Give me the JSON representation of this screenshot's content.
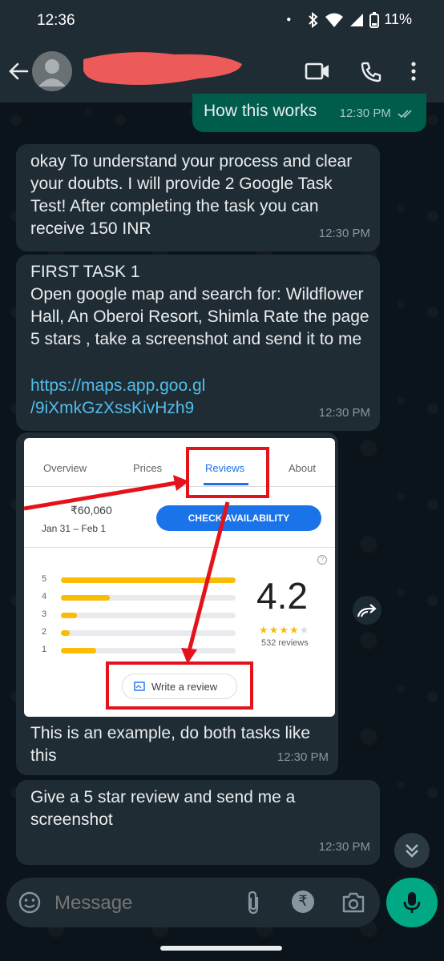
{
  "status_bar": {
    "time": "12:36",
    "battery": "11%"
  },
  "header": {
    "contact_name": ""
  },
  "messages": {
    "m0": {
      "text": "How this works",
      "time": "12:30 PM"
    },
    "m1": {
      "text": "okay To understand your process and clear your doubts. I will provide 2 Google Task Test! After completing the task you can receive 150 INR",
      "time": "12:30 PM"
    },
    "m2": {
      "text": "FIRST TASK 1\nOpen google map and search for: Wildflower Hall, An Oberoi Resort, Shimla Rate the page 5 stars , take a screenshot and send it to me",
      "link": "https://maps.app.goo.gl/9iXmkGzXssKivHzh9",
      "link_line1": "https://maps.app.goo.gl",
      "link_line2": "/9iXmkGzXssKivHzh9",
      "time": "12:30 PM"
    },
    "m3": {
      "caption": "This is an example, do both tasks like this",
      "time": "12:30 PM"
    },
    "m4": {
      "text": "Give a 5 star review and send me a screenshot",
      "time": "12:30 PM"
    }
  },
  "example_screenshot": {
    "tabs": [
      "Overview",
      "Prices",
      "Reviews",
      "About"
    ],
    "active_tab": "Reviews",
    "price": "₹60,060",
    "dates": "Jan 31 – Feb 1",
    "check_button": "CHECK AVAILABILITY",
    "rating": "4.2",
    "rating_stars": 4,
    "review_count": "532 reviews",
    "rating_rows": [
      {
        "label": "5",
        "fraction": 1.0
      },
      {
        "label": "4",
        "fraction": 0.28
      },
      {
        "label": "3",
        "fraction": 0.09
      },
      {
        "label": "2",
        "fraction": 0.05
      },
      {
        "label": "1",
        "fraction": 0.2
      }
    ],
    "write_review": "Write a review"
  },
  "input": {
    "placeholder": "Message"
  },
  "colors": {
    "incoming": "#202c33",
    "outgoing": "#005c4b",
    "accent": "#00a884",
    "link": "#53bdeb",
    "annotation": "#e4131b"
  },
  "icons": [
    "back-arrow-icon",
    "video-call-icon",
    "phone-icon",
    "more-vert-icon",
    "forward-icon",
    "double-chevron-down-icon",
    "emoji-icon",
    "attach-icon",
    "rupee-icon",
    "camera-icon",
    "mic-icon"
  ]
}
